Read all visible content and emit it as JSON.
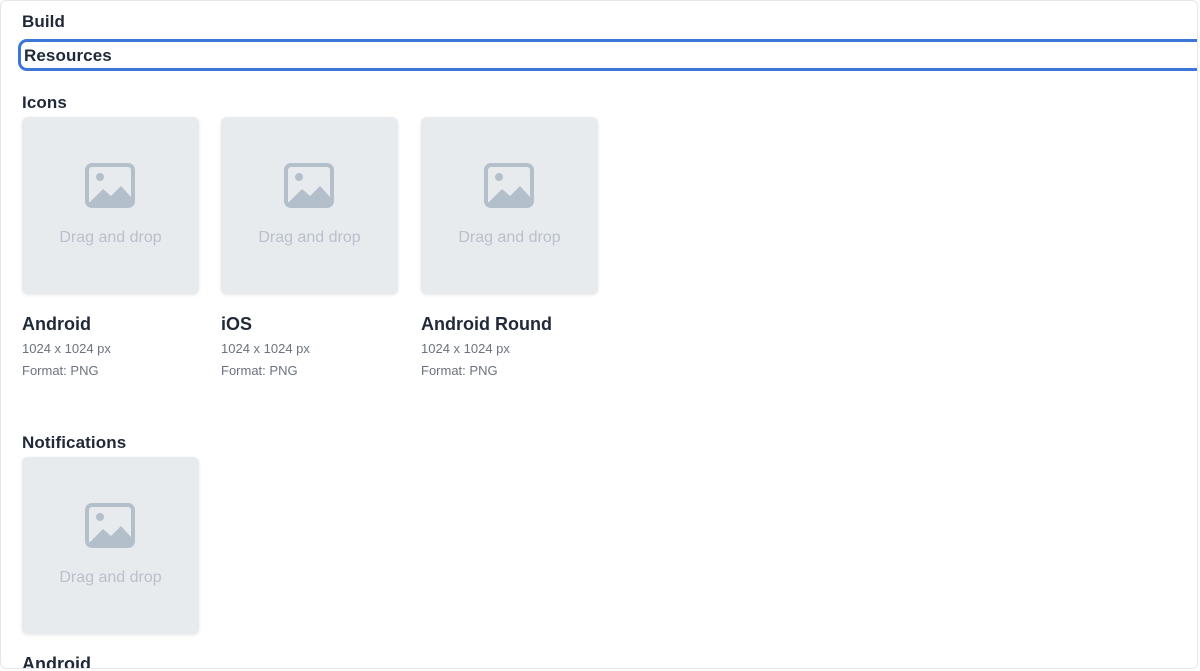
{
  "nav": {
    "build_label": "Build",
    "resources_label": "Resources"
  },
  "sections": {
    "icons": {
      "title": "Icons",
      "items": [
        {
          "dropzone_label": "Drag and drop",
          "name": "Android",
          "size": "1024 x 1024 px",
          "format": "Format: PNG"
        },
        {
          "dropzone_label": "Drag and drop",
          "name": "iOS",
          "size": "1024 x 1024 px",
          "format": "Format: PNG"
        },
        {
          "dropzone_label": "Drag and drop",
          "name": "Android Round",
          "size": "1024 x 1024 px",
          "format": "Format: PNG"
        }
      ]
    },
    "notifications": {
      "title": "Notifications",
      "items": [
        {
          "dropzone_label": "Drag and drop",
          "name": "Android"
        }
      ]
    }
  },
  "colors": {
    "accent": "#3b76d8",
    "dropzone_bg": "#e8ebee",
    "placeholder_icon": "#b4bfcc",
    "text_primary": "#1f2937",
    "text_secondary": "#6b7280"
  },
  "icons": {
    "placeholder": "image-placeholder-icon"
  }
}
